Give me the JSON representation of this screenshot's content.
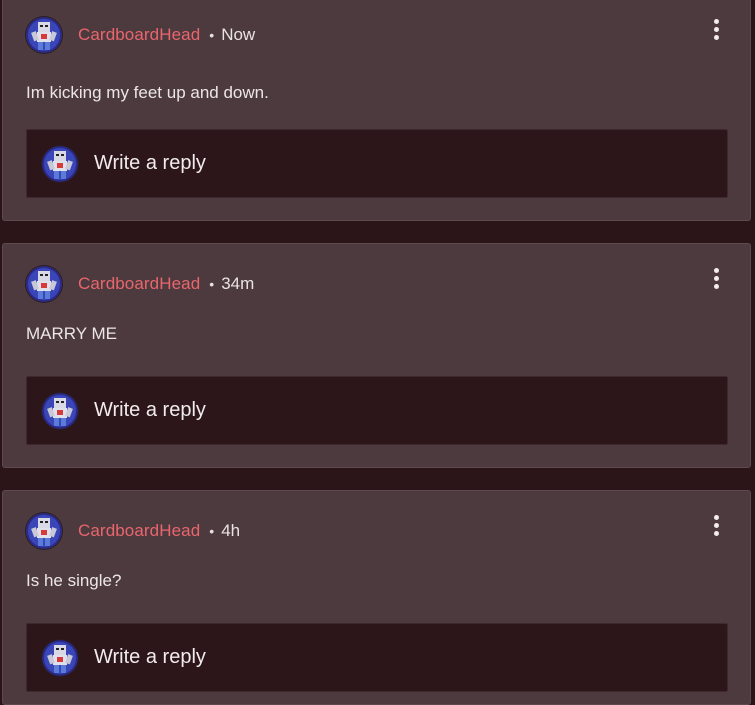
{
  "comments": [
    {
      "username": "CardboardHead",
      "separator": "•",
      "time": "Now",
      "text": "Im kicking my feet up and down.",
      "reply_placeholder": "Write a reply"
    },
    {
      "username": "CardboardHead",
      "separator": "•",
      "time": "34m",
      "text": "MARRY ME",
      "reply_placeholder": "Write a reply"
    },
    {
      "username": "CardboardHead",
      "separator": "•",
      "time": "4h",
      "text": "Is he single?",
      "reply_placeholder": "Write a reply"
    }
  ],
  "colors": {
    "background": "#2b1519",
    "card": "#4d3a3e",
    "reply_box": "#2d161a",
    "username": "#e8666d",
    "text": "#ece6e7"
  },
  "icons": {
    "avatar": "avatar-icon",
    "more": "more-vertical-icon"
  }
}
